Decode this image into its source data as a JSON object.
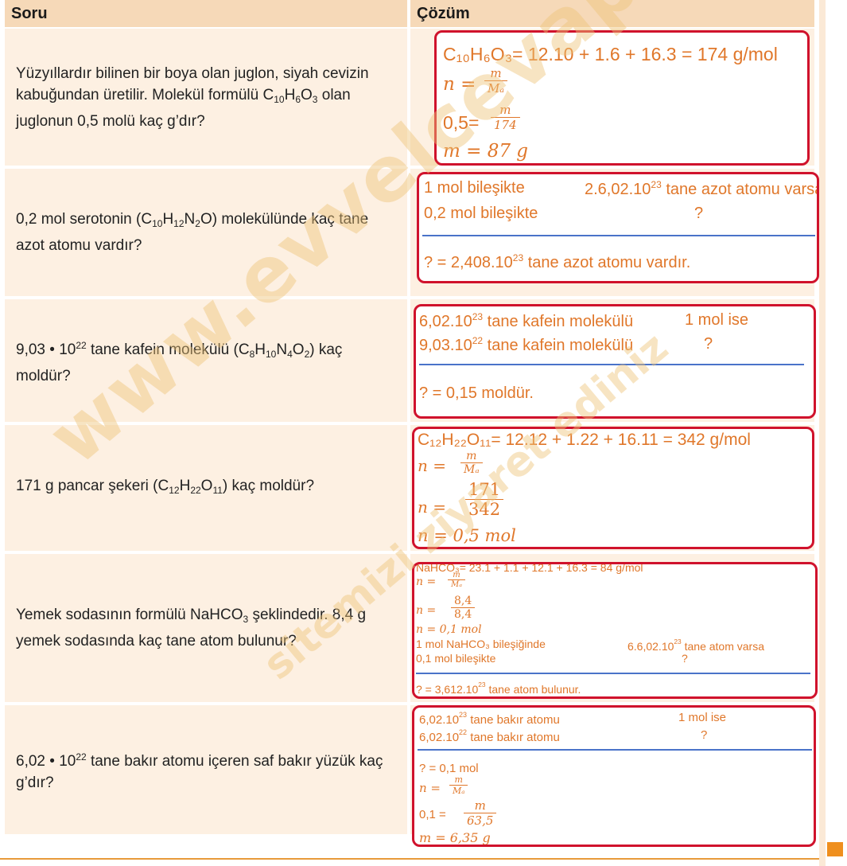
{
  "header": {
    "question": "Soru",
    "solution": "Çözüm"
  },
  "rows": [
    {
      "question_parts": [
        "Yüzyıllardır bilinen bir boya olan juglon, siyah cevizin kabuğundan üretilir. Molekül formülü C",
        "10",
        "H",
        "6",
        "O",
        "3",
        " olan juglonun 0,5 molü kaç g’dır?"
      ],
      "solution": {
        "formula_line": "C₁₀H₆O₃= 12.10 + 1.6 + 16.3 = 174 g/mol",
        "n_eq": "n =",
        "frac1": [
          "m",
          "Mₐ"
        ],
        "value_eq": "0,5=",
        "frac2": [
          "m",
          "174"
        ],
        "result": "m =  87 g"
      }
    },
    {
      "question_parts": [
        "0,2 mol serotonin (C",
        "10",
        "H",
        "12",
        "N",
        "2",
        "O) molekülünde kaç tane azot atomu vardır?"
      ],
      "solution": {
        "line1_left": "1 mol bileşikte",
        "line1_right_pre": "2.6,02.10",
        "line1_right_exp": "23",
        "line1_right_post": " tane azot atomu varsa",
        "line2_left": "0,2 mol bileşikte",
        "line2_right": "?",
        "result_pre": "? = 2,408.10",
        "result_exp": "23",
        "result_post": " tane azot atomu vardır."
      }
    },
    {
      "question_parts": [
        "9,03 • 10",
        "22",
        " tane kafein molekülü (C",
        "8",
        "H",
        "10",
        "N",
        "4",
        "O",
        "2",
        ") kaç moldür?"
      ],
      "solution": {
        "line1_pre": "6,02.10",
        "line1_exp": "23",
        "line1_post": " tane kafein molekülü",
        "line1_right": "1 mol ise",
        "line2_pre": "9,03.10",
        "line2_exp": "22",
        "line2_post": " tane kafein molekülü",
        "line2_right": "?",
        "result": "? = 0,15 moldür."
      }
    },
    {
      "question_parts": [
        "171 g pancar şekeri (C",
        "12",
        "H",
        "22",
        "O",
        "11",
        ") kaç moldür?"
      ],
      "solution": {
        "formula_line": "C₁₂H₂₂O₁₁= 12.12 + 1.22 + 16.11 = 342 g/mol",
        "n_eq": "n =",
        "frac1": [
          "m",
          "Mₐ"
        ],
        "n_eq2": "n  =",
        "frac2": [
          "171",
          "342"
        ],
        "result": "n =  0,5 mol"
      }
    },
    {
      "question_parts": [
        "Yemek sodasının formülü NaHCO",
        "3",
        " şeklindedir. 8,4 g yemek sodasında kaç tane atom bulunur?"
      ],
      "solution": {
        "formula_line": "NaHCO₃= 23.1 + 1.1 + 12.1 + 16.3 = 84 g/mol",
        "n_eq": "n =",
        "frac1": [
          "m",
          "Mₐ"
        ],
        "n_eq2": "n  =",
        "frac2": [
          "8,4",
          "8,4"
        ],
        "n_result": "n  = 0,1 mol",
        "line1_left": "1 mol NaHCO₃ bileşiğinde",
        "line1_right_pre": "6.6,02.10",
        "line1_right_exp": "23",
        "line1_right_post": " tane atom varsa",
        "line2_left": "0,1 mol bileşikte",
        "line2_right": "?",
        "result_pre": "? = 3,612.10",
        "result_exp": "23",
        "result_post": " tane atom bulunur."
      }
    },
    {
      "question_parts": [
        "6,02 •  10",
        "22",
        " tane bakır atomu içeren saf bakır yüzük kaç g’dır?"
      ],
      "solution": {
        "line1_pre": "6,02.10",
        "line1_exp": "23",
        "line1_post": " tane bakır atomu",
        "line1_right": "1 mol ise",
        "line2_pre": "6,02.10",
        "line2_exp": "22",
        "line2_post": " tane bakır atomu",
        "line2_right": "?",
        "mid": "? = 0,1 mol",
        "n_eq": "n =",
        "frac1": [
          "m",
          "Mₐ"
        ],
        "value_eq": "0,1  =",
        "frac2": [
          "m",
          "63,5"
        ],
        "result": "m =  6,35 g"
      }
    }
  ],
  "watermark": {
    "main": "www.evvelcevap.com",
    "sub": "sitemizi ziyaret ediniz"
  }
}
